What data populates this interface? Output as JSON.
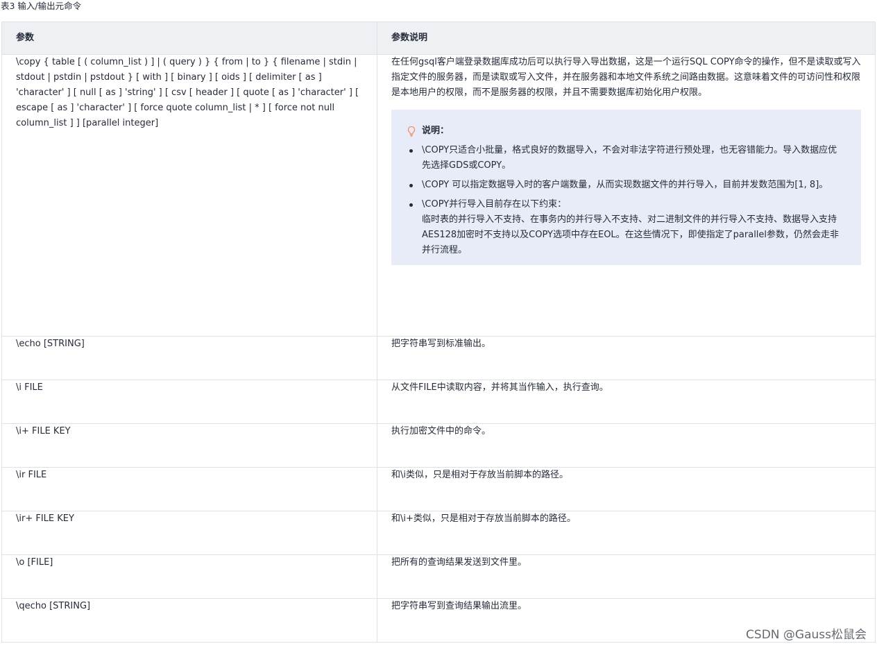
{
  "caption": "表3 输入/输出元命令",
  "table": {
    "headers": [
      "参数",
      "参数说明"
    ],
    "first_row": {
      "param": "\\copy { table [ ( column_list ) ] | ( query ) } { from | to } { filename | stdin | stdout | pstdin | pstdout } [ with ] [ binary ] [ oids ] [ delimiter [ as ] 'character' ] [ null [ as ] 'string' ] [ csv [ header ] [ quote [ as ] 'character' ] [ escape [ as ] 'character' ] [ force quote column_list | * ] [ force not null column_list ] ] [parallel integer]",
      "description": "在任何gsql客户端登录数据库成功后可以执行导入导出数据，这是一个运行SQL COPY命令的操作，但不是读取或写入指定文件的服务器，而是读取或写入文件，并在服务器和本地文件系统之间路由数据。这意味着文件的可访问性和权限是本地用户的权限，而不是服务器的权限，并且不需要数据库初始化用户权限。",
      "note": {
        "title": "说明：",
        "items": [
          "\\COPY只适合小批量，格式良好的数据导入，不会对非法字符进行预处理，也无容错能力。导入数据应优先选择GDS或COPY。",
          "\\COPY 可以指定数据导入时的客户端数量，从而实现数据文件的并行导入，目前并发数范围为[1, 8]。",
          "\\COPY并行导入目前存在以下约束："
        ],
        "item3_detail": "临时表的并行导入不支持、在事务内的并行导入不支持、对二进制文件的并行导入不支持、数据导入支持AES128加密时不支持以及COPY选项中存在EOL。在这些情况下，即使指定了parallel参数，仍然会走非并行流程。"
      }
    },
    "rows": [
      {
        "param": "\\echo [STRING]",
        "description": "把字符串写到标准输出。"
      },
      {
        "param": "\\i FILE",
        "description": "从文件FILE中读取内容，并将其当作输入，执行查询。"
      },
      {
        "param": "\\i+ FILE KEY",
        "description": "执行加密文件中的命令。"
      },
      {
        "param": "\\ir FILE",
        "description": "和\\i类似，只是相对于存放当前脚本的路径。"
      },
      {
        "param": "\\ir+ FILE KEY",
        "description": "和\\i+类似，只是相对于存放当前脚本的路径。"
      },
      {
        "param": "\\o [FILE]",
        "description": "把所有的查询结果发送到文件里。"
      },
      {
        "param": "\\qecho [STRING]",
        "description": "把字符串写到查询结果输出流里。"
      }
    ]
  },
  "watermark": "CSDN @Gauss松鼠会",
  "colors": {
    "header_bg": "#eff0f3",
    "note_bg": "#e8ecf8",
    "border": "#dfe1e6",
    "bulb": "#f0906a"
  }
}
